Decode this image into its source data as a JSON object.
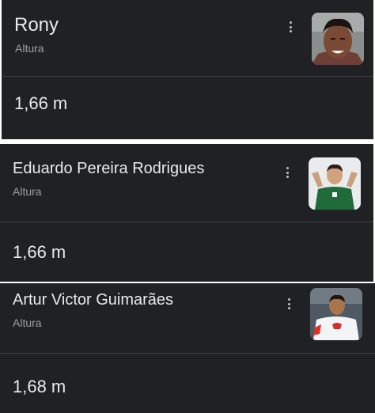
{
  "results": [
    {
      "name": "Rony",
      "attribute": "Altura",
      "value": "1,66 m",
      "image": "player-photo"
    },
    {
      "name": "Eduardo Pereira Rodrigues",
      "attribute": "Altura",
      "value": "1,66 m",
      "image": "player-photo"
    },
    {
      "name": "Artur Victor Guimarães",
      "attribute": "Altura",
      "value": "1,68 m",
      "image": "player-photo"
    }
  ],
  "icons": {
    "menu": "more-vert-icon"
  },
  "colors": {
    "card_bg": "#202124",
    "divider": "#3c4043",
    "primary_text": "#e8eaed",
    "secondary_text": "#9aa0a6"
  }
}
